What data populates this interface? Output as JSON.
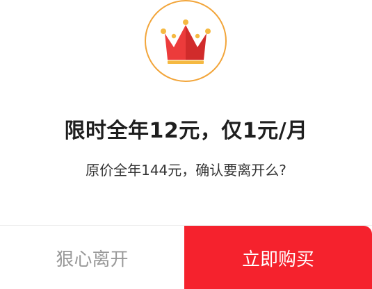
{
  "dialog": {
    "icon": "crown-icon",
    "title": "限时全年12元，仅1元/月",
    "subtitle": "原价全年144元，确认要离开么?",
    "leave_label": "狠心离开",
    "buy_label": "立即购买"
  },
  "colors": {
    "accent": "#f5222d",
    "badge_ring": "#f2a53a",
    "crown_red": "#e83a3a",
    "crown_gold": "#f5b942",
    "leave_text": "#999999"
  }
}
